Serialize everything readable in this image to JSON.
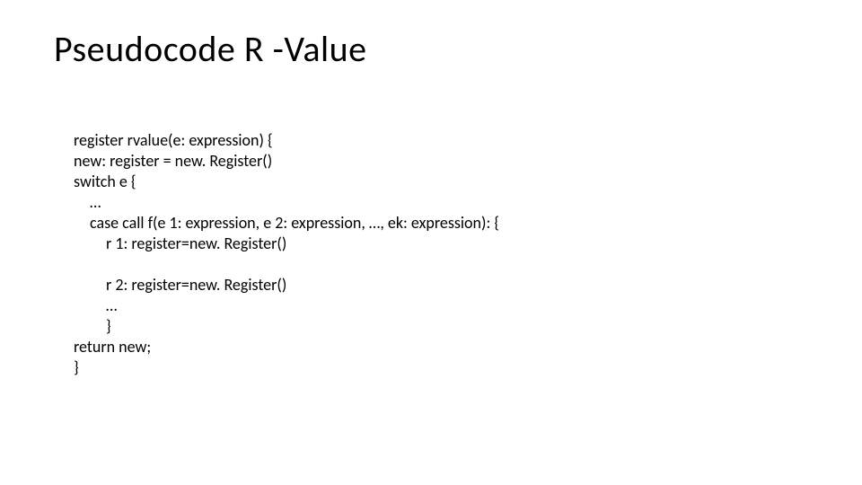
{
  "title": "Pseudocode R -Value",
  "lines": {
    "l1": "register rvalue(e: expression) {",
    "l2": "new: register = new. Register()",
    "l3": "switch e {",
    "l4": "…",
    "l5": "case call f(e 1: expression, e 2: expression, …, ek: expression): {",
    "l6": "r 1: register=new. Register()",
    "l7": "",
    "l8": "r 2: register=new. Register()",
    "l9": "…",
    "l10": "}",
    "l11": "return new;",
    "l12": "}"
  }
}
